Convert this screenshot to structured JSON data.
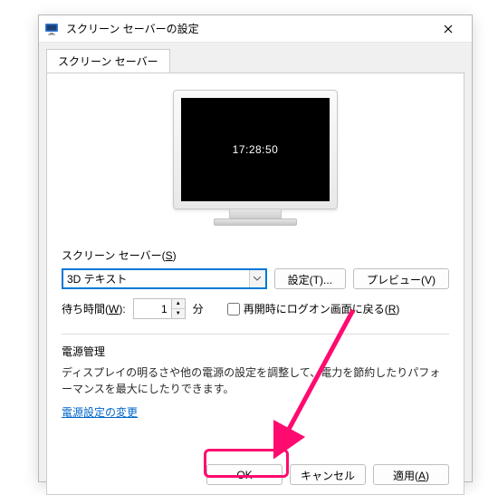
{
  "window": {
    "title": "スクリーン セーバーの設定"
  },
  "tab": {
    "label": "スクリーン セーバー"
  },
  "preview": {
    "clock": "17:28:50"
  },
  "screensaver": {
    "section_label_pre": "スクリーン セーバー(",
    "section_accel": "S",
    "section_label_post": ")",
    "selected": "3D テキスト",
    "settings_label": "設定(T)...",
    "preview_label": "プレビュー(V)"
  },
  "wait": {
    "label_pre": "待ち時間(",
    "label_accel": "W",
    "label_post": "):",
    "value": "1",
    "unit": "分",
    "resume_label_pre": "再開時にログオン画面に戻る(",
    "resume_accel": "R",
    "resume_label_post": ")"
  },
  "power": {
    "heading": "電源管理",
    "description": "ディスプレイの明るさや他の電源の設定を調整して、電力を節約したりパフォーマンスを最大にしたりできます。",
    "link": "電源設定の変更"
  },
  "buttons": {
    "ok": "OK",
    "cancel": "キャンセル",
    "apply_pre": "適用(",
    "apply_accel": "A",
    "apply_post": ")"
  }
}
